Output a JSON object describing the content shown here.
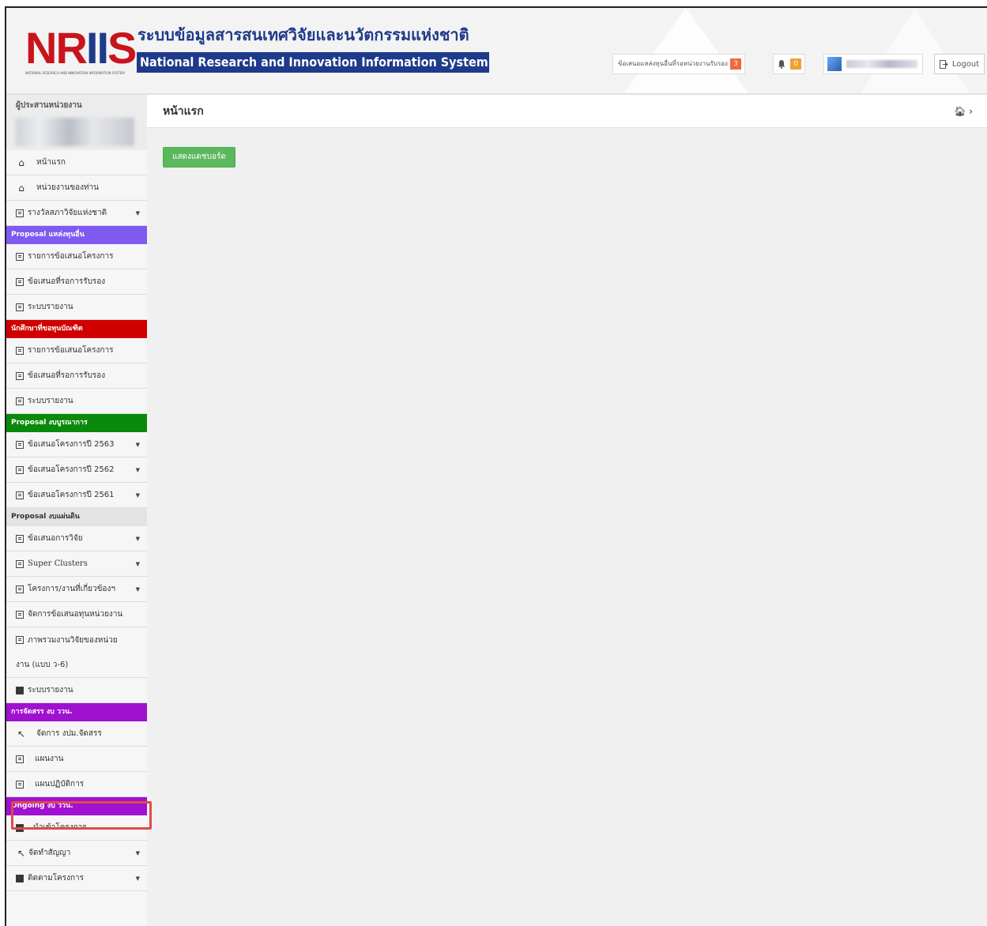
{
  "header": {
    "logo_text": "NRIIS",
    "logo_tagline": "NATIONAL RESEARCH AND INNOVATION INFORMATION SYSTEM",
    "title_th": "ระบบข้อมูลสารสนเทศวิจัยและนวัตกรรมแห่งชาติ",
    "title_en": "National Research and Innovation Information System",
    "pending_label": "ข้อเสนอแหล่งทุนอื่นที่รอหน่วยงานรับรอง",
    "pending_count": "3",
    "notification_count": "0",
    "logout_label": "Logout"
  },
  "sidebar": {
    "coordinator_label": "ผู้ประสานหน่วยงาน",
    "top_items": [
      {
        "label": "หน้าแรก",
        "icon": "home-outline-icon"
      },
      {
        "label": "หน่วยงานของท่าน",
        "icon": "home-icon"
      },
      {
        "label": "รางวัลสภาวิจัยแห่งชาติ",
        "icon": "list-icon"
      }
    ],
    "sections": [
      {
        "title": "Proposal แหล่งทุนอื่น",
        "color": "#7f5af0",
        "items": [
          "รายการข้อเสนอโครงการ",
          "ข้อเสนอที่รอการรับรอง",
          "ระบบรายงาน"
        ]
      },
      {
        "title": "นักศึกษาที่ขอทุนบัณฑิต",
        "color": "#d00000",
        "items": [
          "รายการข้อเสนอโครงการ",
          "ข้อเสนอที่รอการรับรอง",
          "ระบบรายงาน"
        ]
      },
      {
        "title": "Proposal งบบูรณาการ",
        "color": "#0a8a0a",
        "items": [
          "ข้อเสนอโครงการปี 2563",
          "ข้อเสนอโครงการปี 2562",
          "ข้อเสนอโครงการปี 2561"
        ]
      },
      {
        "title": "Proposal งบแผ่นดิน",
        "color": "#e3e3e3",
        "items": [
          "ข้อเสนอการวิจัย",
          "Super Clusters",
          "โครงการ/งานที่เกี่ยวข้องฯ",
          "จัดการข้อเสนอทุนหน่วยงาน",
          "ภาพรวมงานวิจัยของหน่วย",
          "งาน (แบบ ว-6)",
          "ระบบรายงาน"
        ]
      },
      {
        "title": "การจัดสรร งบ ววน.",
        "color": "#a010d0",
        "items": [
          "จัดการ งปม.จัดสรร",
          "แผนงาน",
          "แผนปฏิบัติการ"
        ]
      },
      {
        "title": "Ongoing งบ ววน.",
        "color": "#a010d0",
        "items": [
          "นำเข้าโครงการ",
          "จัดทำสัญญา",
          "ติดตามโครงการ"
        ]
      }
    ]
  },
  "main": {
    "page_title": "หน้าแรก",
    "dashboard_button": "แสดงแดชบอร์ด"
  }
}
